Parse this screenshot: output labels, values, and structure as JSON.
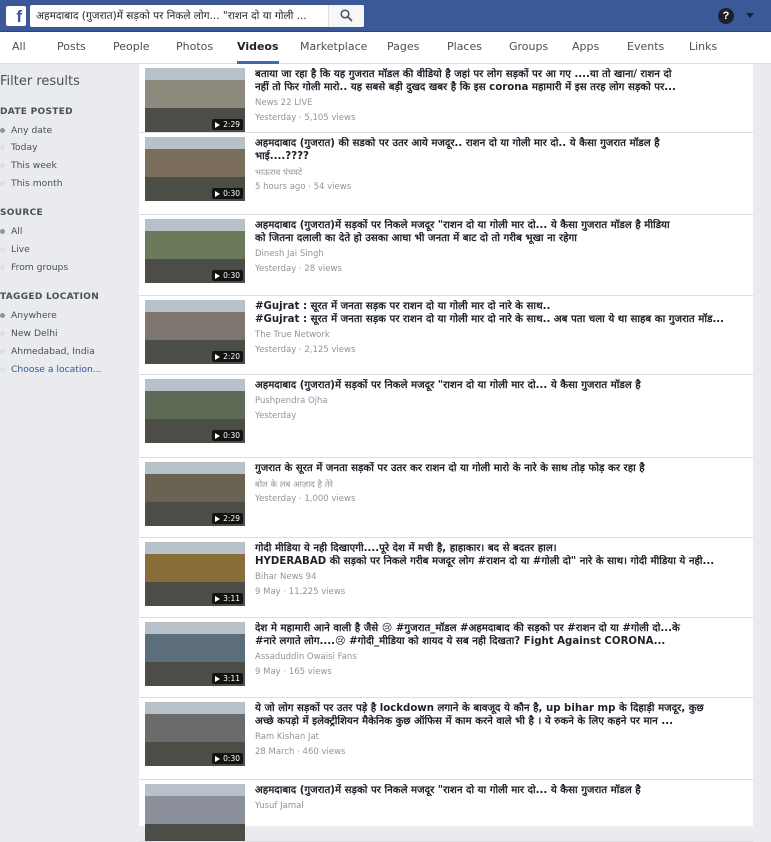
{
  "search": {
    "query": "अहमदाबाद (गुजरात)में सड़को पर निकले लोग... \"राशन दो या गोली ..."
  },
  "tabs": [
    "All",
    "Posts",
    "People",
    "Photos",
    "Videos",
    "Marketplace",
    "Pages",
    "Places",
    "Groups",
    "Apps",
    "Events",
    "Links"
  ],
  "filter": {
    "title": "Filter results",
    "date_heading": "DATE POSTED",
    "date_options": [
      "Any date",
      "Today",
      "This week",
      "This month"
    ],
    "source_heading": "SOURCE",
    "source_options": [
      "All",
      "Live",
      "From groups"
    ],
    "location_heading": "TAGGED LOCATION",
    "location_options": [
      "Anywhere",
      "New Delhi",
      "Ahmedabad, India",
      "Choose a location..."
    ]
  },
  "videos": [
    {
      "lines": [
        "बताया जा रहा है कि यह गुजरात मॉडल की वीडियो है जहां पर लोग सड़कों पर आ गए ....या तो खाना/ राशन दो",
        "नहीं तो फिर गोली मारो.. यह सबसे बड़ी दुखद खबर है कि इस corona महामारी में इस तरह लोग सड़को पर..."
      ],
      "source": "News 22 LIVE",
      "meta": "Yesterday · 5,105 views",
      "duration": "2:29"
    },
    {
      "lines": [
        "अहमदाबाद (गुजरात) की सडको पर उतर आये मजदूर.. राशन दो या गोली मार दो.. ये कैसा गुजरात मॉडल है",
        "भाई....????"
      ],
      "source": "भाऊराव पंचवटे",
      "meta": "5 hours ago · 54 views",
      "duration": "0:30"
    },
    {
      "lines": [
        "अहमदाबाद (गुजरात)में सड़कों पर निकले मजदूर \"राशन दो या गोली मार दो... ये कैसा गुजरात मॉडल है मीडिया",
        "को जितना दलाली का देते हो उसका आधा भी जनता में बाट दो तो गरीब भूखा ना रहेगा"
      ],
      "source": "Dinesh Jai Singh",
      "meta": "Yesterday · 28 views",
      "duration": "0:30"
    },
    {
      "lines": [
        "#Gujrat : सूरत में जनता सड़क पर राशन दो या गोली मार दो नारे के साथ..",
        "#Gujrat : सूरत में जनता सड़क पर राशन दो या गोली मार दो नारे के साथ.. अब पता चला ये था साहब का गुजरात मॉड..."
      ],
      "source": "The True Network",
      "meta": "Yesterday · 2,125 views",
      "duration": "2:20"
    },
    {
      "lines": [
        "अहमदाबाद (गुजरात)में सड़कों पर निकले मजदूर \"राशन दो या गोली मार दो... ये कैसा गुजरात मॉडल है"
      ],
      "source": "Pushpendra Ojha",
      "meta": "Yesterday",
      "duration": "0:30"
    },
    {
      "lines": [
        "गुजरात के सूरत में जनता सड़कों पर उतर कर राशन दो या गोली मारो के नारे के साथ तोड़ फोड़ कर रहा है"
      ],
      "source": "बोल के लब आज़ाद है तेरे",
      "meta": "Yesterday · 1,000 views",
      "duration": "2:29"
    },
    {
      "lines": [
        "गोदी मीडिया ये नही दिखाएगी....पूरे देश में मची है, हाहाकार। बद से बदतर हाल।",
        "HYDERABAD की सड़को पर निकले गरीब मजदूर लोग #राशन दो या #गोली दो\" नारे के साथ। गोदी मीडिया ये नही..."
      ],
      "source": "Bihar News 94",
      "meta": "9 May · 11,225 views",
      "duration": "3:11"
    },
    {
      "lines": [
        "देश मे महामारी आने वाली है जैसे 😢 #गुजरात_मॉडल #अहमदाबाद की सड़को पर #राशन दो या #गोली दो...के",
        "#नारे लगाते लोग....😢 #गोदी_मीडिया को शायद ये सब नही दिखता? Fight Against CORONA..."
      ],
      "source": "Assaduddin Owaisi Fans",
      "meta": "9 May · 165 views",
      "duration": "3:11"
    },
    {
      "lines": [
        "ये जो लोग सड़कों पर उतर पड़े है lockdown लगाने के बावजूद ये कौन है, up bihar mp के दिहाड़ी मजदूर, कुछ",
        "अच्छे कपड़ो में इलेक्ट्रीशियन मैकेनिक कुछ ऑफिस में काम करने वाले भी है । ये रुकने के लिए कहने पर मान ..."
      ],
      "source": "Ram Kishan Jat",
      "meta": "28 March · 460 views",
      "duration": "0:30"
    },
    {
      "lines": [
        "अहमदाबाद (गुजरात)में सड़को पर निकले मजदूर \"राशन दो या गोली मार दो... ये कैसा गुजरात मॉडल है"
      ],
      "source": "Yusuf Jamal",
      "meta": "",
      "duration": ""
    }
  ],
  "colors": {
    "brand": "#3b5998",
    "link": "#385898",
    "muted": "#90949c"
  }
}
